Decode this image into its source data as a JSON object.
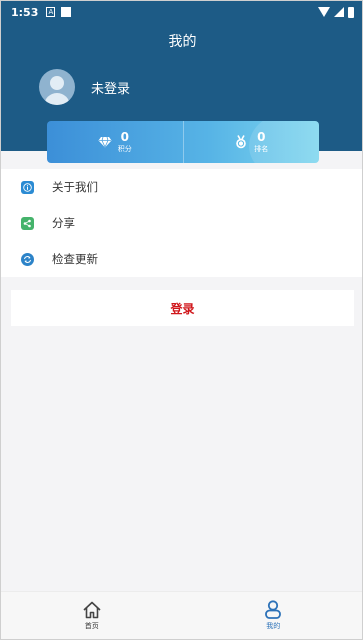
{
  "statusbar": {
    "time": "1:53",
    "icon_a": "A"
  },
  "header": {
    "title": "我的"
  },
  "user": {
    "name": "未登录"
  },
  "stats": [
    {
      "icon": "diamond-icon",
      "value": "0",
      "label": "积分"
    },
    {
      "icon": "medal-icon",
      "value": "0",
      "label": "排名"
    }
  ],
  "menu": [
    {
      "icon": "info-icon",
      "label": "关于我们",
      "color": "#2b8bd3"
    },
    {
      "icon": "share-icon",
      "label": "分享",
      "color": "#45b36b"
    },
    {
      "icon": "refresh-icon",
      "label": "检查更新",
      "color": "#2c83c8"
    }
  ],
  "login": {
    "label": "登录",
    "color": "#d0161b"
  },
  "bottom_nav": [
    {
      "icon": "home-icon",
      "label": "首页"
    },
    {
      "icon": "user-icon",
      "label": "我的"
    }
  ],
  "colors": {
    "header_bg": "#1d5b86",
    "accent": "#2d72b8"
  }
}
